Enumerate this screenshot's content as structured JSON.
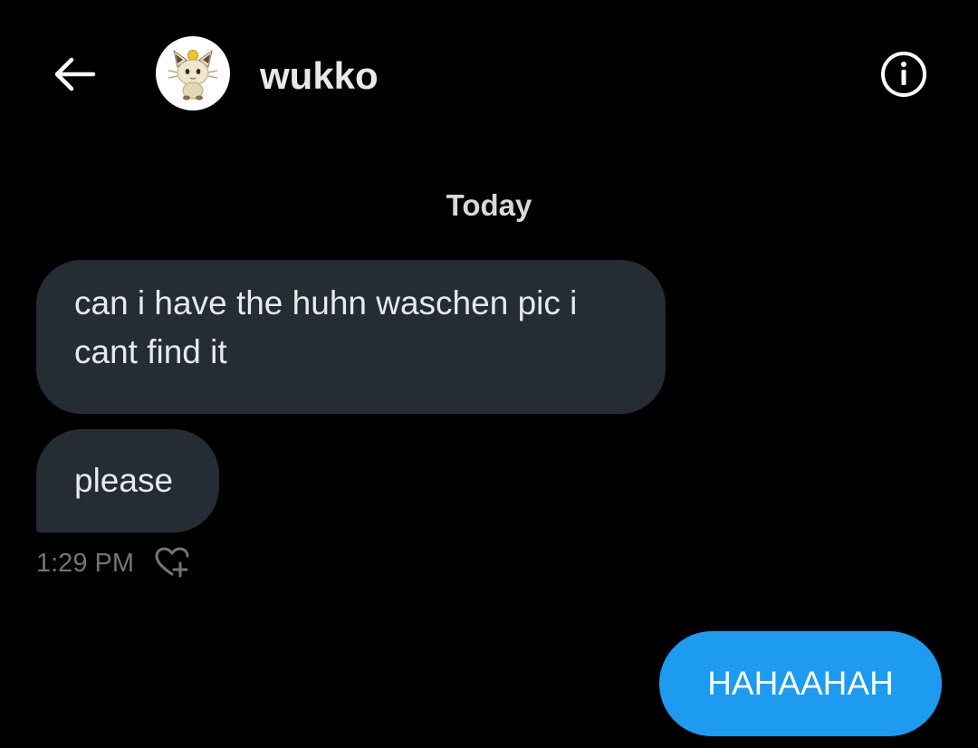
{
  "header": {
    "back_icon": "arrow-left-icon",
    "avatar_icon": "meowth-avatar",
    "username": "wukko",
    "info_icon": "info-circle-icon"
  },
  "conversation": {
    "date_separator": "Today",
    "incoming": [
      {
        "text": "can i have the huhn waschen pic i cant find it"
      },
      {
        "text": "please"
      }
    ],
    "incoming_timestamp": "1:29 PM",
    "reaction_icon": "heart-plus-icon",
    "outgoing": [
      {
        "text": "HAHAAHAH"
      }
    ]
  },
  "colors": {
    "background": "#000000",
    "incoming_bubble": "#252c33",
    "outgoing_bubble": "#1d9bf0",
    "timestamp_text": "#71767b"
  }
}
